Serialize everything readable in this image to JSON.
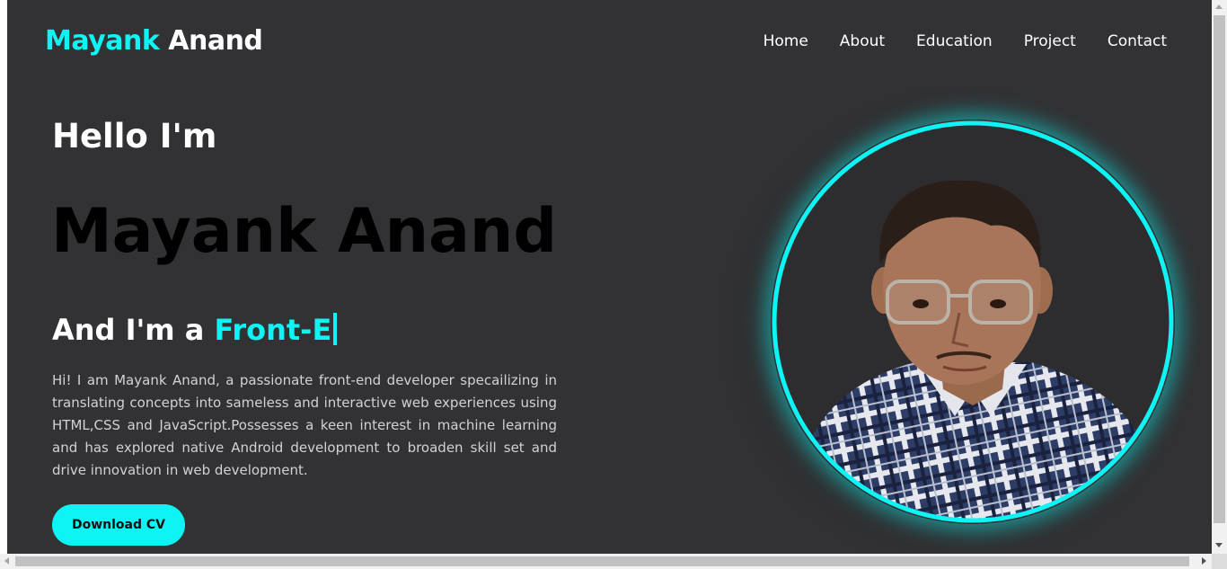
{
  "header": {
    "logo_first": "Mayank",
    "logo_last": "Anand",
    "nav": [
      "Home",
      "About",
      "Education",
      "Project",
      "Contact"
    ]
  },
  "hero": {
    "greeting": "Hello I'm",
    "name": "Mayank Anand",
    "role_prefix": "And I'm a",
    "role_typed": "Front-E",
    "description": "Hi! I am Mayank Anand, a passionate front-end developer specailizing in translating concepts into sameless and interactive web experiences using HTML,CSS and JavaScript.Possesses a keen interest in machine learning and has explored native Android development to broaden skill set and drive innovation in web development.",
    "cta_label": "Download CV"
  },
  "colors": {
    "background": "#323234",
    "accent": "#0ef4f4",
    "text": "#ffffff",
    "name_text": "#000000"
  },
  "icons": {
    "profile_photo": "person-portrait-photo"
  }
}
